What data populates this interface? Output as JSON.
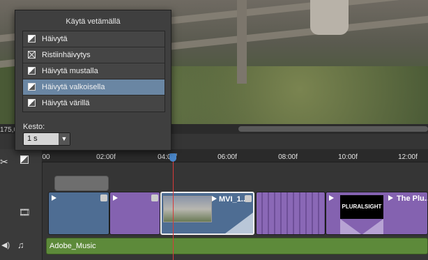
{
  "preview": {
    "time_readout": "175,0"
  },
  "transitions_popup": {
    "title": "Käytä vetämällä",
    "items": [
      {
        "label": "Häivytä",
        "icon": "fade-icon"
      },
      {
        "label": "Ristiinhäivytys",
        "icon": "cross-dissolve-icon"
      },
      {
        "label": "Häivytä mustalla",
        "icon": "fade-black-icon"
      },
      {
        "label": "Häivytä valkoisella",
        "icon": "fade-white-icon",
        "selected": true
      },
      {
        "label": "Häivytä värillä",
        "icon": "fade-color-icon"
      }
    ],
    "duration_label": "Kesto:",
    "duration_value": "1 s"
  },
  "ruler": {
    "ticks": [
      "00",
      "02:00f",
      "04:00f",
      "06:00f",
      "08:00f",
      "10:00f",
      "12:00f"
    ]
  },
  "clips": {
    "video_clip_title": "MVI_1...",
    "title_clip_title": "The Plu...",
    "title_clip_thumb_text": "PLURALSIGHT"
  },
  "audio": {
    "clip_name": "Adobe_Music"
  },
  "colors": {
    "accent_selected": "#6a86a3",
    "playhead": "#d83a3a",
    "video_clip_blue": "#4e6d93",
    "video_clip_purple": "#8462b0",
    "audio_clip_green": "#5d8a3a"
  }
}
